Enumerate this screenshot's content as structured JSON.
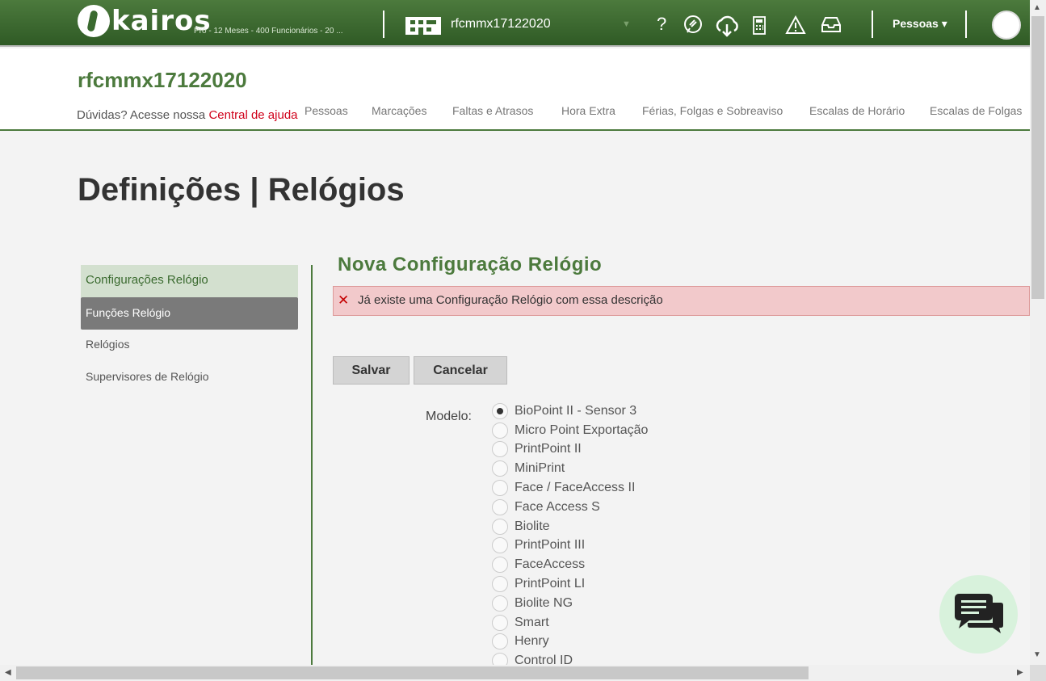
{
  "topbar": {
    "logo_text": "kairos",
    "plan": "Pró - 12 Meses - 400 Funcionários - 20 ...",
    "company_selector": "rfcmmx17122020",
    "icons": [
      "question-icon",
      "feedback-icon",
      "cloud-download-icon",
      "calculator-icon",
      "warning-icon",
      "inbox-icon"
    ],
    "people_menu": "Pessoas"
  },
  "header": {
    "company_title": "rfcmmx17122020",
    "help_prefix": "Dúvidas? Acesse nossa ",
    "help_link": "Central de ajuda",
    "nav": [
      "Pessoas",
      "Marcações",
      "Faltas e Atrasos",
      "Hora Extra",
      "Férias, Folgas e Sobreaviso",
      "Escalas de Horário",
      "Escalas de Folgas"
    ]
  },
  "page_title": "Definições | Relógios",
  "sidebar": {
    "items": [
      {
        "label": "Configurações Relógio",
        "state": "active"
      },
      {
        "label": "Funções Relógio",
        "state": "hover"
      },
      {
        "label": "Relógios",
        "state": "normal"
      },
      {
        "label": "Supervisores de Relógio",
        "state": "normal"
      }
    ]
  },
  "form": {
    "title": "Nova Configuração Relógio",
    "error": "Já existe uma Configuração Relógio com essa descrição",
    "save": "Salvar",
    "cancel": "Cancelar",
    "model_label": "Modelo:",
    "models": [
      "BioPoint II - Sensor 3",
      "Micro Point Exportação",
      "PrintPoint II",
      "MiniPrint",
      "Face / FaceAccess II",
      "Face Access S",
      "Biolite",
      "PrintPoint III",
      "FaceAccess",
      "PrintPoint LI",
      "Biolite NG",
      "Smart",
      "Henry",
      "Control ID"
    ],
    "selected_model": "BioPoint II - Sensor 3"
  },
  "colors": {
    "brand_green": "#4c7a3d",
    "error_bg": "#f2c9cb",
    "error_x": "#c40000",
    "help_link": "#d0021b"
  }
}
